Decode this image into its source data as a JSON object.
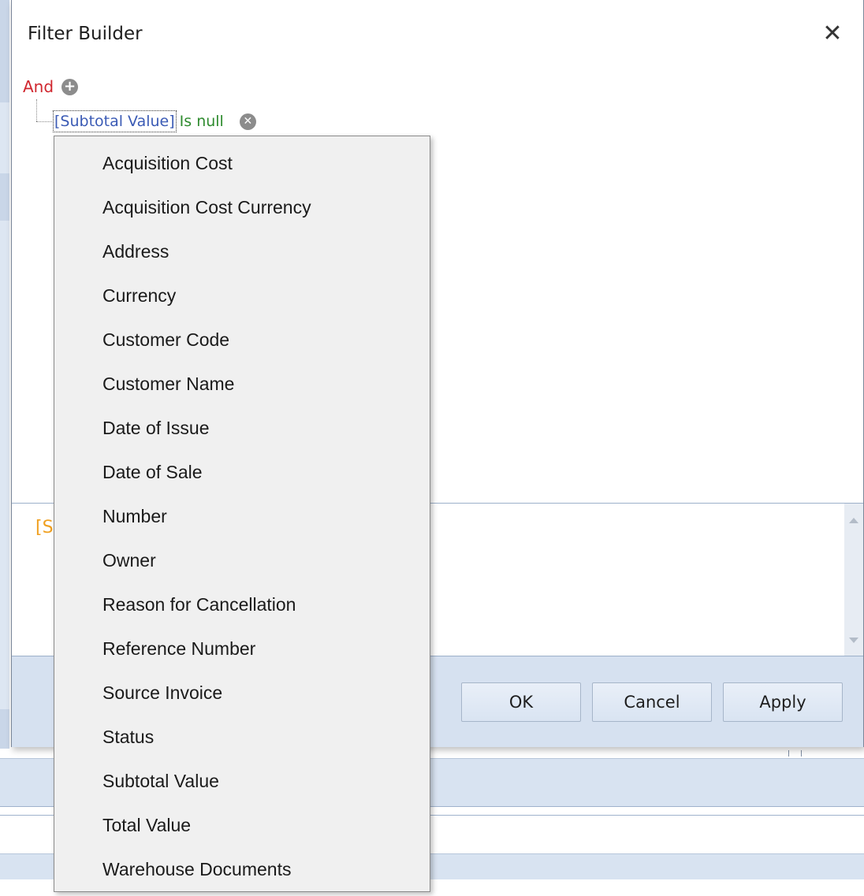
{
  "dialog": {
    "title": "Filter Builder",
    "close_glyph": "✕"
  },
  "tree": {
    "group_operator": "And",
    "condition": {
      "field": "[Subtotal Value]",
      "operator": "Is null"
    }
  },
  "expression": {
    "text": "[S"
  },
  "buttons": {
    "ok": "OK",
    "cancel": "Cancel",
    "apply": "Apply"
  },
  "field_list": {
    "items": [
      "Acquisition Cost",
      "Acquisition Cost Currency",
      "Address",
      "Currency",
      "Customer Code",
      "Customer Name",
      "Date of Issue",
      "Date of Sale",
      "Number",
      "Owner",
      "Reason for Cancellation",
      "Reference Number",
      "Source Invoice",
      "Status",
      "Subtotal Value",
      "Total Value",
      "Warehouse Documents"
    ]
  },
  "icons": {
    "add": "add-circle-icon",
    "remove": "remove-circle-icon",
    "close": "close-icon"
  },
  "colors": {
    "group_operator": "#d0262e",
    "field": "#3b5bb5",
    "operator": "#2e8b2e",
    "expression": "#f0a020",
    "footer": "#d6e1f0"
  }
}
